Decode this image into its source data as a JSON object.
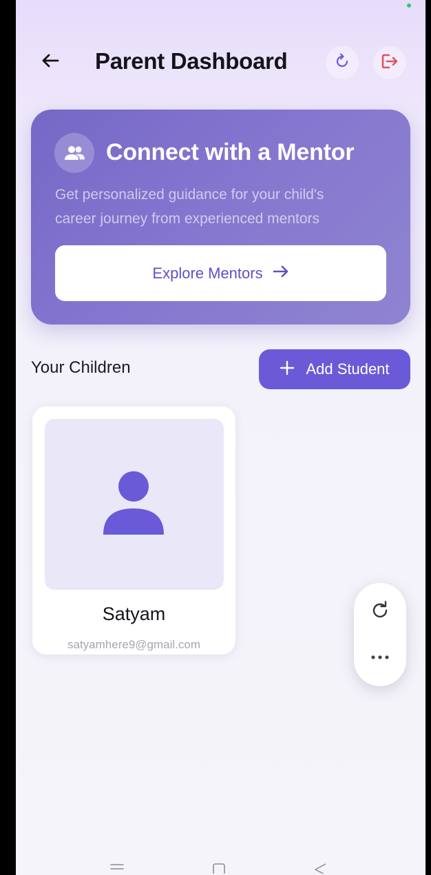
{
  "header": {
    "title": "Parent Dashboard",
    "icons": {
      "back": "arrow-left-icon",
      "refresh": "refresh-icon",
      "logout": "logout-icon"
    }
  },
  "mentor_card": {
    "title": "Connect with a Mentor",
    "description": "Get personalized guidance for your child's career journey from experienced mentors",
    "button_label": "Explore Mentors",
    "icon": "users-icon"
  },
  "children_section": {
    "title": "Your Children",
    "add_button_label": "Add Student",
    "children": [
      {
        "name": "Satyam",
        "email": "satyamhere9@gmail.com"
      }
    ]
  },
  "colors": {
    "accent": "#6a5ad8",
    "mentor_card": "#7d70cb",
    "logout": "#e0555a",
    "status_dot": "#2ecc71"
  }
}
